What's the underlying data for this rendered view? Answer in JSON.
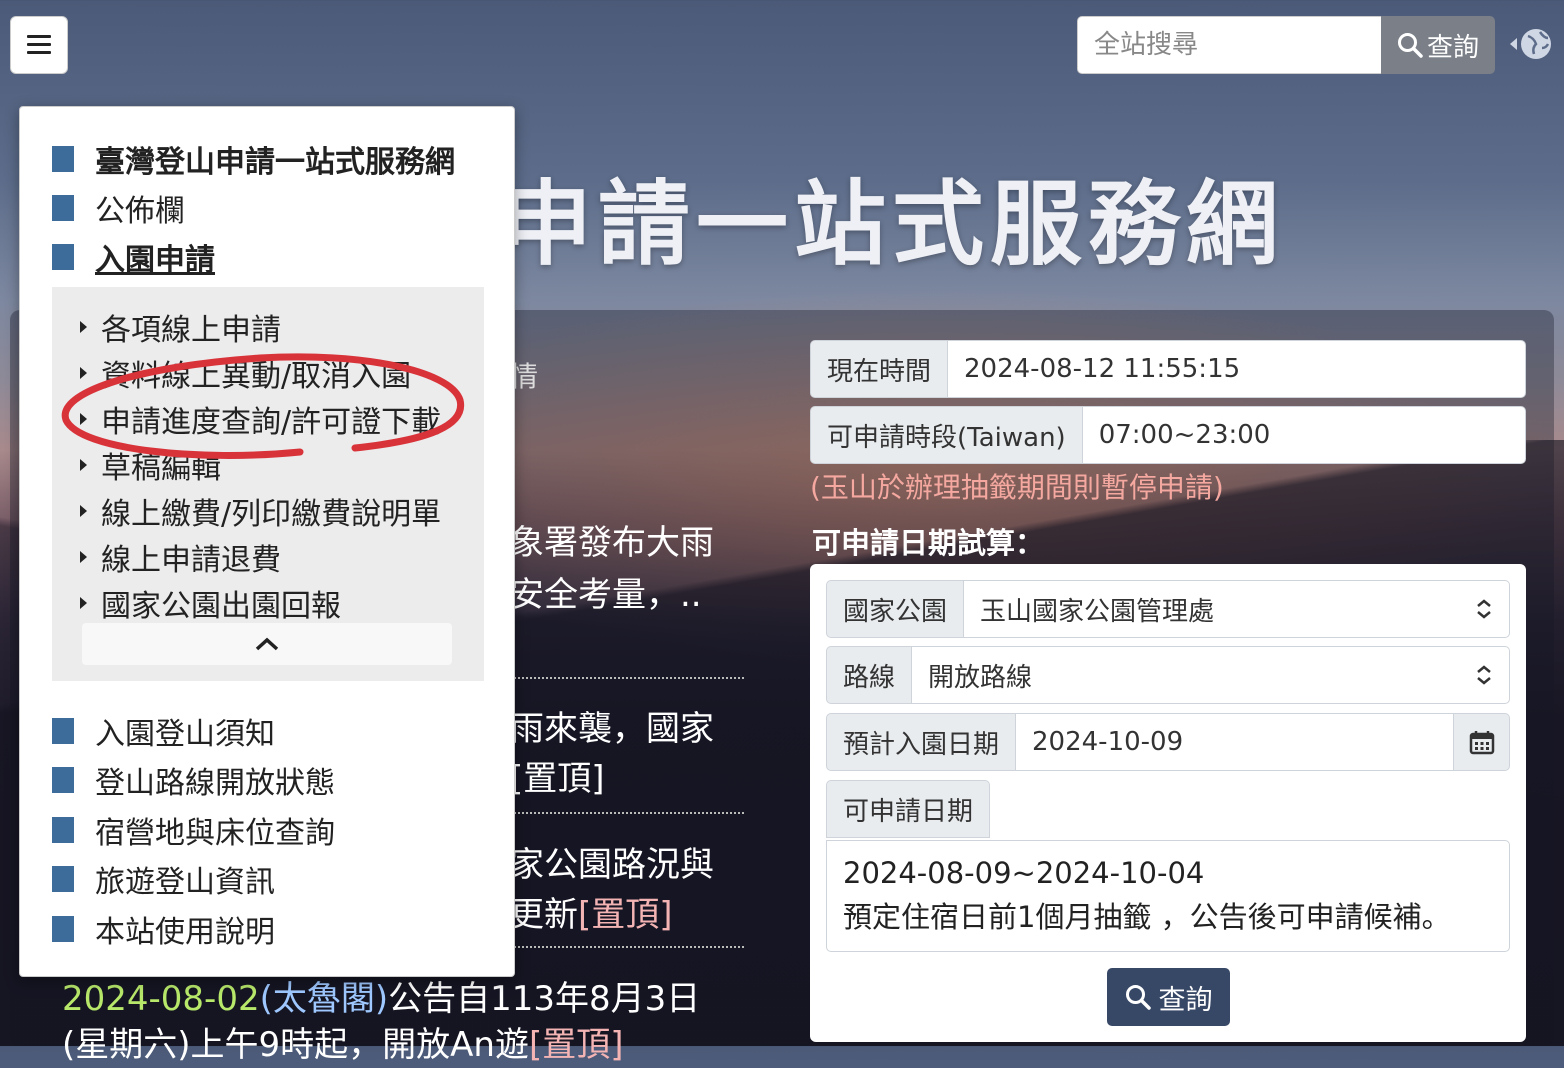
{
  "header": {
    "search_placeholder": "全站搜尋",
    "search_button": "查詢",
    "hero_title": "申請一站式服務網"
  },
  "menu": {
    "items_top": [
      {
        "label": "臺灣登山申請一站式服務網"
      },
      {
        "label": "公佈欄"
      },
      {
        "label": "入園申請"
      }
    ],
    "subitems": [
      {
        "label": "各項線上申請"
      },
      {
        "label": "資料線上異動/取消入園"
      },
      {
        "label": "申請進度查詢/許可證下載"
      },
      {
        "label": "草稿編輯"
      },
      {
        "label": "線上繳費/列印繳費說明單"
      },
      {
        "label": "線上申請退費"
      },
      {
        "label": "國家公園出園回報"
      }
    ],
    "items_bottom": [
      {
        "label": "入園登山須知"
      },
      {
        "label": "登山路線開放狀態"
      },
      {
        "label": "宿營地與床位查詢"
      },
      {
        "label": "旅遊登山資訊"
      },
      {
        "label": "本站使用說明"
      }
    ],
    "accent": "#3d6b9a",
    "highlight_circle_color": "#d9333a"
  },
  "news": {
    "fragments": [
      {
        "text": "情"
      },
      {
        "text": "象署發布大雨"
      },
      {
        "text": "安全考量，.."
      },
      {
        "text": "雨來襲，國家"
      },
      {
        "text": "[置頂]"
      },
      {
        "text": "家公園路況與"
      },
      {
        "text": "更新"
      },
      {
        "text": "[置頂]"
      }
    ],
    "bottom": {
      "date": "2024-08-02",
      "site": "(太魯閣)",
      "text1": "公告自113年8月3日",
      "text2": "(星期六)上午9時起，開放An遊",
      "pin": "[置頂]"
    }
  },
  "info": {
    "now_label": "現在時間",
    "now_value": "2024-08-12 11:55:15",
    "period_label": "可申請時段(Taiwan)",
    "period_value": "07:00~23:00",
    "note": "(玉山於辦理抽籤期間則暫停申請)"
  },
  "calc": {
    "title": "可申請日期試算：",
    "park_label": "國家公園",
    "park_value": "玉山國家公園管理處",
    "route_label": "路線",
    "route_value": "開放路線",
    "date_label": "預計入園日期",
    "date_value": "2024-10-09",
    "result_label": "可申請日期",
    "result_line1": "2024-08-09~2024-10-04",
    "result_line2": "預定住宿日前1個月抽籤 ，公告後可申請候補。",
    "button": "查詢",
    "button_color": "#374766"
  }
}
